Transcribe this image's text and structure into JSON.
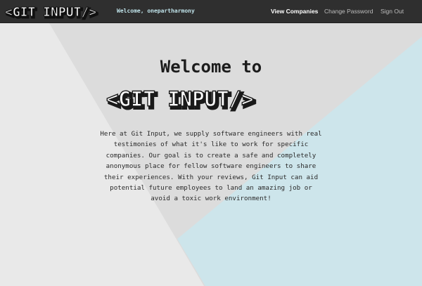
{
  "app": {
    "brand_name": "<GIT INPUT/>"
  },
  "navbar": {
    "welcome_text": "Welcome, onepartharmony",
    "links": [
      {
        "label": "View Companies",
        "active": true
      },
      {
        "label": "Change Password",
        "active": false
      },
      {
        "label": "Sign Out",
        "active": false
      }
    ]
  },
  "hero": {
    "title": "Welcome to",
    "logo_text": "<GIT INPUT/>",
    "description": "Here at Git Input, we supply software engineers with real testimonies of what it's like to work for specific companies. Our goal is to create a safe and completely anonymous place for fellow software engineers to share their experiences. With your reviews, Git Input can aid potential future employees to land an amazing job or avoid a toxic work environment!"
  },
  "colors": {
    "navbar_bg": "#2f2f2f",
    "welcome_text": "#bfe3ea",
    "bg_light": "#e9e9e9",
    "bg_gray": "#dcdcdc",
    "bg_blue": "#cde5eb"
  }
}
